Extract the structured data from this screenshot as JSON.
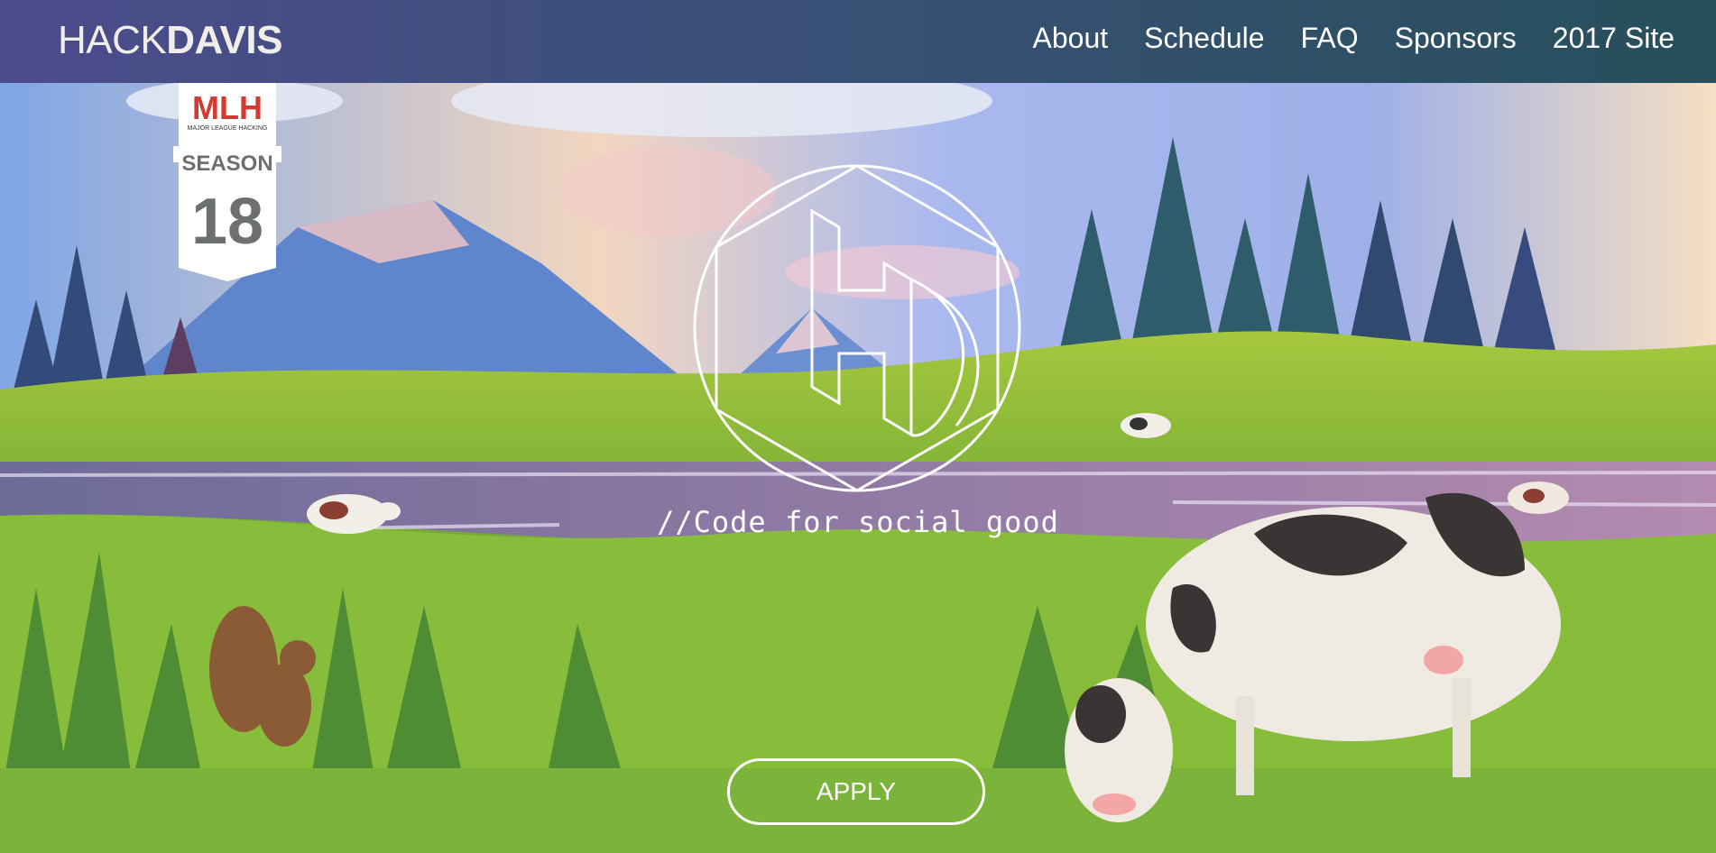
{
  "nav": {
    "brand_light": "HACK",
    "brand_bold": "DAVIS",
    "links": [
      "About",
      "Schedule",
      "FAQ",
      "Sponsors",
      "2017 Site"
    ]
  },
  "badge": {
    "logo": "MLH",
    "tagline": "MAJOR LEAGUE HACKING",
    "season_label": "SEASON",
    "season_number": "18"
  },
  "hero": {
    "logo_icon": "hackdavis-hexagon-logo-icon",
    "tagline": "//Code for social good",
    "apply_label": "APPLY"
  },
  "colors": {
    "nav_start": "#4c4c8c",
    "nav_end": "#274f5c",
    "grass": "#8bbf3c",
    "water": "#6f6d9c",
    "sky_top": "#7f9ce0"
  }
}
